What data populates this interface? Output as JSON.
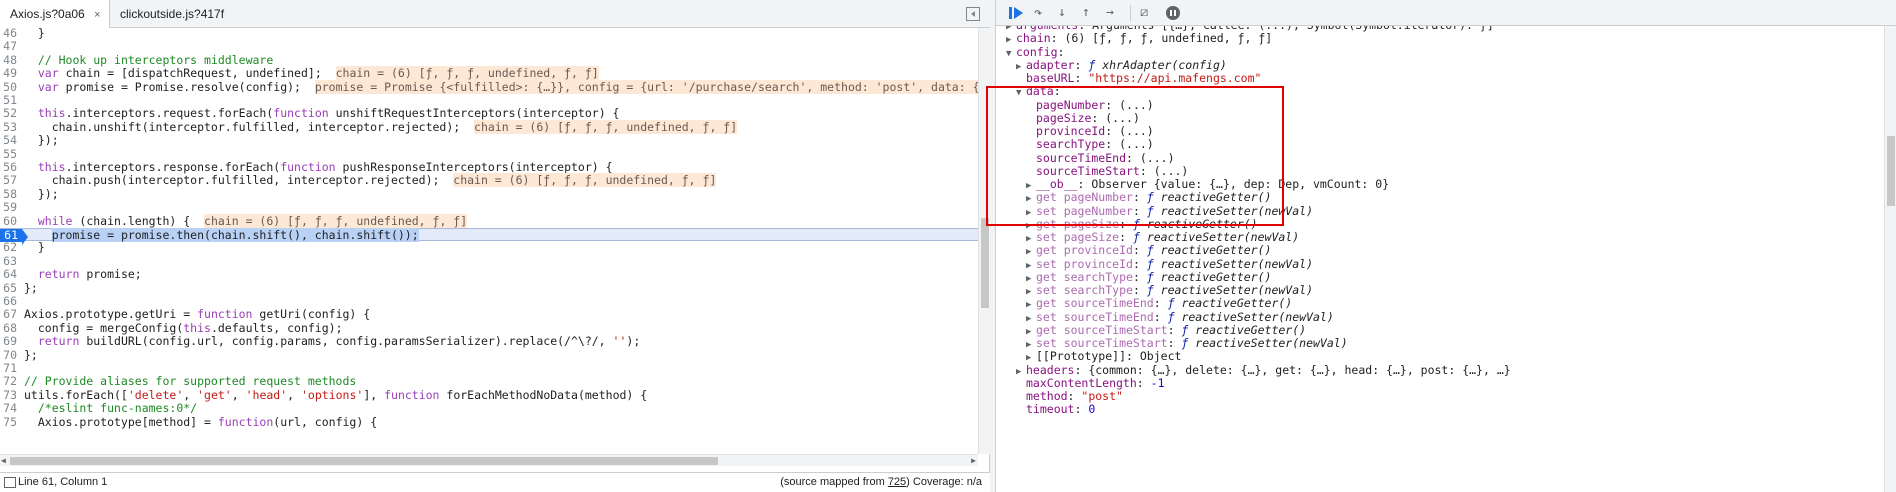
{
  "editor": {
    "tabs": [
      {
        "label": "Axios.js?0a06",
        "close": "×"
      },
      {
        "label": "clickoutside.js?417f"
      }
    ],
    "lines": [
      {
        "no": "46",
        "text": "  }"
      },
      {
        "no": "47",
        "text": ""
      },
      {
        "no": "48",
        "text": "  // Hook up interceptors middleware"
      },
      {
        "no": "49",
        "code": "  var chain = [dispatchRequest, undefined];",
        "inline": "chain = (6) [ƒ, ƒ, ƒ, undefined, ƒ, ƒ]"
      },
      {
        "no": "50",
        "code": "  var promise = Promise.resolve(config);",
        "inline": "promise = Promise {<fulfilled>: {…}}, config = {url: '/purchase/search', method: 'post', data: {…}, hea"
      },
      {
        "no": "51",
        "text": ""
      },
      {
        "no": "52",
        "text": "  this.interceptors.request.forEach(function unshiftRequestInterceptors(interceptor) {"
      },
      {
        "no": "53",
        "code": "    chain.unshift(interceptor.fulfilled, interceptor.rejected);",
        "inline": "chain = (6) [ƒ, ƒ, ƒ, undefined, ƒ, ƒ]"
      },
      {
        "no": "54",
        "text": "  });"
      },
      {
        "no": "55",
        "text": ""
      },
      {
        "no": "56",
        "text": "  this.interceptors.response.forEach(function pushResponseInterceptors(interceptor) {"
      },
      {
        "no": "57",
        "code": "    chain.push(interceptor.fulfilled, interceptor.rejected);",
        "inline": "chain = (6) [ƒ, ƒ, ƒ, undefined, ƒ, ƒ]"
      },
      {
        "no": "58",
        "text": "  });"
      },
      {
        "no": "59",
        "text": ""
      },
      {
        "no": "60",
        "code": "  while (chain.length) {",
        "inline": "chain = (6) [ƒ, ƒ, ƒ, undefined, ƒ, ƒ]"
      },
      {
        "no": "61",
        "text": "    promise = promise.then(chain.shift(), chain.shift());",
        "current": true
      },
      {
        "no": "62",
        "text": "  }"
      },
      {
        "no": "63",
        "text": ""
      },
      {
        "no": "64",
        "text": "  return promise;"
      },
      {
        "no": "65",
        "text": "};"
      },
      {
        "no": "66",
        "text": ""
      },
      {
        "no": "67",
        "text": "Axios.prototype.getUri = function getUri(config) {"
      },
      {
        "no": "68",
        "text": "  config = mergeConfig(this.defaults, config);"
      },
      {
        "no": "69",
        "text": "  return buildURL(config.url, config.params, config.paramsSerializer).replace(/^\\?/, '');"
      },
      {
        "no": "70",
        "text": "};"
      },
      {
        "no": "71",
        "text": ""
      },
      {
        "no": "72",
        "text": "// Provide aliases for supported request methods"
      },
      {
        "no": "73",
        "text": "utils.forEach(['delete', 'get', 'head', 'options'], function forEachMethodNoData(method) {"
      },
      {
        "no": "74",
        "text": "  /*eslint func-names:0*/"
      },
      {
        "no": "75",
        "text": "  Axios.prototype[method] = function(url, config) {"
      }
    ]
  },
  "status": {
    "position": "Line 61, Column 1",
    "source_prefix": "(source mapped from ",
    "source_link": "725",
    "source_suffix": ")  Coverage: n/a"
  },
  "scope": {
    "rows": [
      {
        "indent": 0,
        "tog": "▶",
        "key": "arguments",
        "val": "Arguments [{…}, callee: (...), Symbol(Symbol.iterator): ƒ]"
      },
      {
        "indent": 0,
        "tog": "▶",
        "key": "chain",
        "val": "(6) [ƒ, ƒ, ƒ, undefined, ƒ, ƒ]"
      },
      {
        "indent": 0,
        "tog": "▼",
        "key": "config",
        "val": ""
      },
      {
        "indent": 1,
        "tog": "▶",
        "key": "adapter",
        "fsym": "ƒ",
        "fn": "xhrAdapter(config)"
      },
      {
        "indent": 1,
        "tog": "",
        "key": "baseURL",
        "str": "\"https://api.mafengs.com\""
      },
      {
        "indent": 1,
        "tog": "▼",
        "key": "data",
        "val": ""
      },
      {
        "indent": 2,
        "tog": "",
        "key": "pageNumber",
        "val": "(...)"
      },
      {
        "indent": 2,
        "tog": "",
        "key": "pageSize",
        "val": "(...)"
      },
      {
        "indent": 2,
        "tog": "",
        "key": "provinceId",
        "val": "(...)"
      },
      {
        "indent": 2,
        "tog": "",
        "key": "searchType",
        "val": "(...)"
      },
      {
        "indent": 2,
        "tog": "",
        "key": "sourceTimeEnd",
        "val": "(...)"
      },
      {
        "indent": 2,
        "tog": "",
        "key": "sourceTimeStart",
        "val": "(...)"
      },
      {
        "indent": 2,
        "tog": "▶",
        "key": "__ob__",
        "val": "Observer {value: {…}, dep: Dep, vmCount: 0}"
      },
      {
        "indent": 2,
        "tog": "▶",
        "dim": true,
        "key": "get pageNumber",
        "fsym": "ƒ",
        "fn": "reactiveGetter()"
      },
      {
        "indent": 2,
        "tog": "▶",
        "dim": true,
        "key": "set pageNumber",
        "fsym": "ƒ",
        "fn": "reactiveSetter(newVal)"
      },
      {
        "indent": 2,
        "tog": "▶",
        "dim": true,
        "key": "get pageSize",
        "fsym": "ƒ",
        "fn": "reactiveGetter()"
      },
      {
        "indent": 2,
        "tog": "▶",
        "dim": true,
        "key": "set pageSize",
        "fsym": "ƒ",
        "fn": "reactiveSetter(newVal)"
      },
      {
        "indent": 2,
        "tog": "▶",
        "dim": true,
        "key": "get provinceId",
        "fsym": "ƒ",
        "fn": "reactiveGetter()"
      },
      {
        "indent": 2,
        "tog": "▶",
        "dim": true,
        "key": "set provinceId",
        "fsym": "ƒ",
        "fn": "reactiveSetter(newVal)"
      },
      {
        "indent": 2,
        "tog": "▶",
        "dim": true,
        "key": "get searchType",
        "fsym": "ƒ",
        "fn": "reactiveGetter()"
      },
      {
        "indent": 2,
        "tog": "▶",
        "dim": true,
        "key": "set searchType",
        "fsym": "ƒ",
        "fn": "reactiveSetter(newVal)"
      },
      {
        "indent": 2,
        "tog": "▶",
        "dim": true,
        "key": "get sourceTimeEnd",
        "fsym": "ƒ",
        "fn": "reactiveGetter()"
      },
      {
        "indent": 2,
        "tog": "▶",
        "dim": true,
        "key": "set sourceTimeEnd",
        "fsym": "ƒ",
        "fn": "reactiveSetter(newVal)"
      },
      {
        "indent": 2,
        "tog": "▶",
        "dim": true,
        "key": "get sourceTimeStart",
        "fsym": "ƒ",
        "fn": "reactiveGetter()"
      },
      {
        "indent": 2,
        "tog": "▶",
        "dim": true,
        "key": "set sourceTimeStart",
        "fsym": "ƒ",
        "fn": "reactiveSetter(newVal)"
      },
      {
        "indent": 2,
        "tog": "▶",
        "key": "[[Prototype]]",
        "plain": true,
        "val": "Object"
      },
      {
        "indent": 1,
        "tog": "▶",
        "key": "headers",
        "val": "{common: {…}, delete: {…}, get: {…}, head: {…}, post: {…}, …}"
      },
      {
        "indent": 1,
        "tog": "",
        "key": "maxContentLength",
        "num": "-1"
      },
      {
        "indent": 1,
        "tog": "",
        "key": "method",
        "str": "\"post\""
      },
      {
        "indent": 1,
        "tog": "",
        "key": "timeout",
        "num": "0"
      }
    ]
  },
  "colors": {
    "accent": "#1a73e8",
    "highlight_box": "#e00000",
    "inline_value_bg": "#fde8d6",
    "current_line_bg": "#e3ebfa"
  },
  "icons": [
    "resume-icon",
    "step-over-icon",
    "step-into-icon",
    "step-out-icon",
    "step-icon",
    "deactivate-breakpoints-icon",
    "pause-on-exceptions-icon"
  ]
}
